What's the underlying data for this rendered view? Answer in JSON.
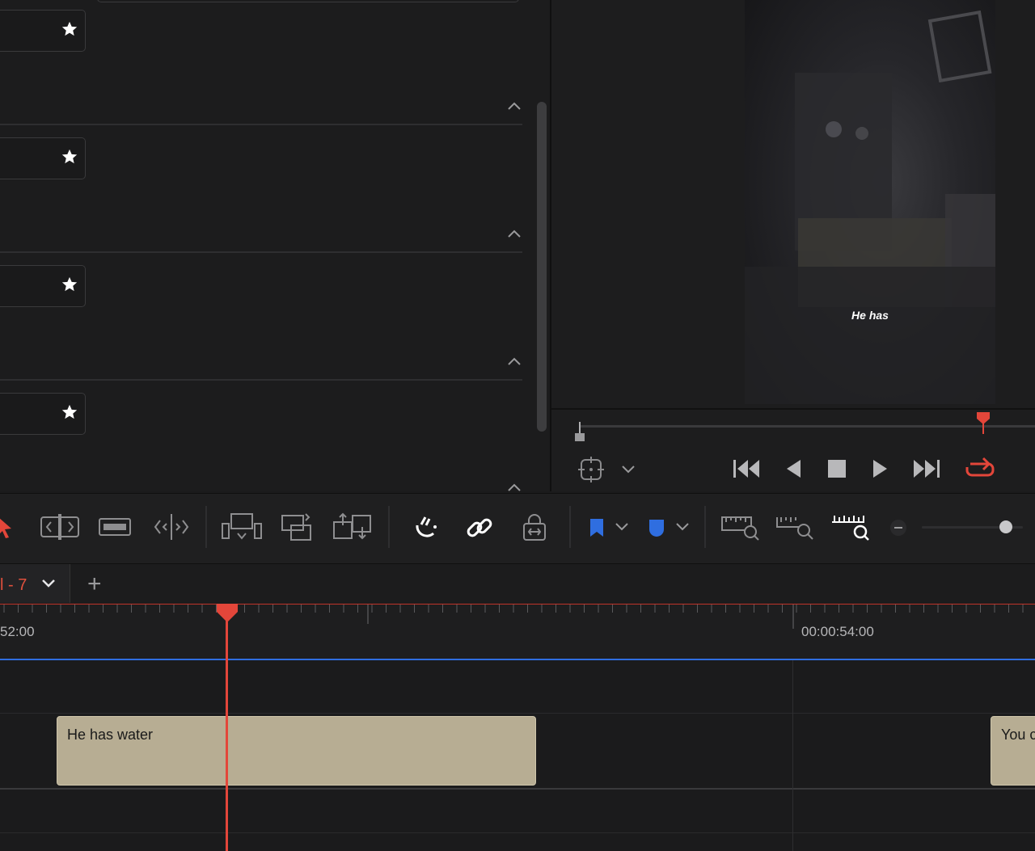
{
  "viewer": {
    "subtitle_text": "He has"
  },
  "timeline": {
    "tab_label": "l - 7",
    "add_tab_label": "+",
    "timecode_left": "52:00",
    "timecode_right": "00:00:54:00",
    "clips": [
      {
        "text": "He has water"
      },
      {
        "text": "You c"
      }
    ]
  },
  "colors": {
    "accent_red": "#e3463a",
    "marker_blue": "#2f6ee0",
    "clip_fill": "#b7ad93"
  },
  "icons": {
    "toolbar": [
      "selection-arrow-icon",
      "trim-edit-icon",
      "dynamic-trim-icon",
      "blade-icon",
      "insert-clip-icon",
      "overwrite-clip-icon",
      "replace-clip-icon",
      "snapping-icon",
      "linked-selection-icon",
      "position-lock-icon",
      "flag-icon",
      "marker-icon",
      "zoom-full-icon",
      "zoom-detail-icon",
      "zoom-custom-icon",
      "zoom-out-icon"
    ],
    "transport": [
      "jump-start-icon",
      "reverse-play-icon",
      "stop-icon",
      "play-icon",
      "jump-end-icon",
      "loop-icon"
    ]
  }
}
